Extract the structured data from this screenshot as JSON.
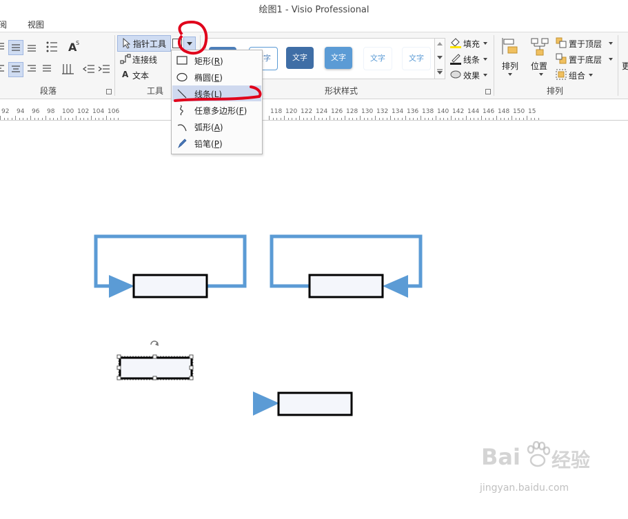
{
  "window": {
    "title": "绘图1 - Visio Professional"
  },
  "tabs": [
    "阅",
    "视图"
  ],
  "ribbon": {
    "groups": {
      "paragraph": "段落",
      "tools": "工具",
      "shape_styles": "形状样式",
      "arrange": "排列"
    },
    "tools": {
      "pointer": "指针工具",
      "connector": "连接线",
      "text": "文本"
    },
    "style_gallery": [
      "文字",
      "文字",
      "文字",
      "文字",
      "文字",
      "文字"
    ],
    "style_options": {
      "fill": "填充",
      "line": "线条",
      "effects": "效果"
    },
    "arrange": {
      "align": "排列",
      "position": "位置",
      "bring_front": "置于顶层",
      "send_back": "置于底层",
      "group": "组合",
      "cut_off": "更"
    }
  },
  "dropdown": {
    "items": [
      {
        "label": "矩形(",
        "key": "R",
        "tail": ")"
      },
      {
        "label": "椭圆(",
        "key": "E",
        "tail": ")"
      },
      {
        "label": "线条(",
        "key": "L",
        "tail": ")"
      },
      {
        "label": "任意多边形(",
        "key": "F",
        "tail": ")"
      },
      {
        "label": "弧形(",
        "key": "A",
        "tail": ")"
      },
      {
        "label": "铅笔(",
        "key": "P",
        "tail": ")"
      }
    ],
    "active_index": 2
  },
  "ruler": {
    "labels": [
      "92",
      "94",
      "96",
      "98",
      "100",
      "102",
      "104",
      "106",
      "118",
      "120",
      "122",
      "124",
      "126",
      "128",
      "130",
      "132",
      "134",
      "136",
      "138",
      "140",
      "142",
      "144",
      "146",
      "148",
      "150",
      "15"
    ]
  },
  "watermark": {
    "brand": "Bai",
    "brand2": "经验",
    "url": "jingyan.baidu.com"
  },
  "colors": {
    "accent": "#5b9bd5",
    "annotation": "#e0001b",
    "menu_active": "#cfd9ef",
    "ribbon_bg": "#f6f6f6"
  }
}
